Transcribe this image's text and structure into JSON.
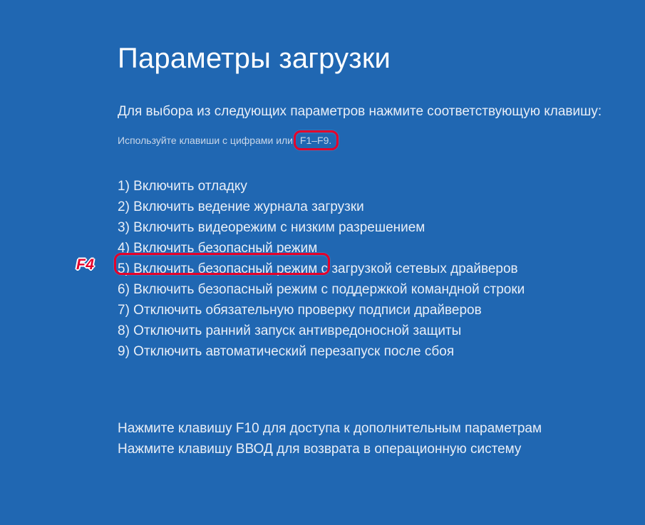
{
  "title": "Параметры загрузки",
  "subtitle": "Для выбора из следующих параметров нажмите соответствующую клавишу:",
  "hint_prefix": "Используйте клавиши с цифрами или ",
  "hint_keys": "F1–F9.",
  "options": [
    "1) Включить отладку",
    "2) Включить ведение журнала загрузки",
    "3) Включить видеорежим с низким разрешением",
    "4) Включить безопасный режим",
    "5) Включить безопасный режим с загрузкой сетевых драйверов",
    "6) Включить безопасный режим с поддержкой командной строки",
    "7) Отключить обязательную проверку подписи драйверов",
    "8) Отключить ранний запуск антивредоносной защиты",
    "9) Отключить автоматический перезапуск после сбоя"
  ],
  "footer_line1": "Нажмите клавишу F10 для доступа к дополнительным параметрам",
  "footer_line2": "Нажмите клавишу ВВОД для возврата в операционную систему",
  "annotation": {
    "key_label": "F4",
    "highlight_color": "#e4002b"
  }
}
